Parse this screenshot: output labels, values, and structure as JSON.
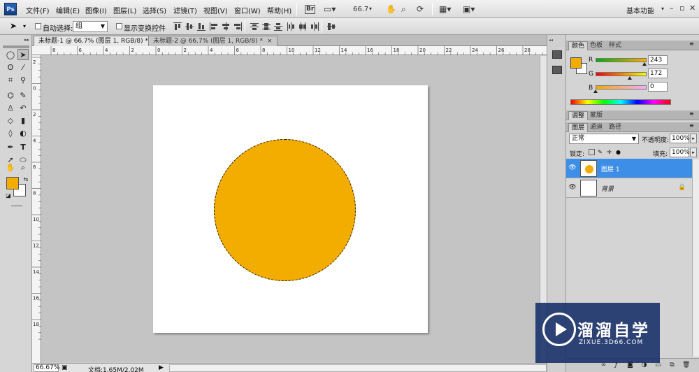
{
  "app": {
    "logo": "Ps",
    "workspace": "基本功能"
  },
  "menu": [
    "文件(F)",
    "编辑(E)",
    "图像(I)",
    "图层(L)",
    "选择(S)",
    "滤镜(T)",
    "视图(V)",
    "窗口(W)",
    "帮助(H)"
  ],
  "menubar": {
    "br_label": "Br",
    "zoom_value": "66.7"
  },
  "options": {
    "auto_select_label": "自动选择:",
    "auto_select_value": "组",
    "show_transform_label": "显示变换控件"
  },
  "tabs": [
    {
      "label": "未标题-1 @ 66.7% (图层 1, RGB/8) *",
      "close": "×"
    },
    {
      "label": "未标题-2 @ 66.7% (图层 1, RGB/8) *",
      "close": "×"
    }
  ],
  "ruler_top_marks": [
    "8",
    "6",
    "4",
    "2",
    "0",
    "2",
    "4",
    "6",
    "8",
    "10",
    "12",
    "14",
    "16",
    "18",
    "20",
    "22",
    "24",
    "26",
    "28"
  ],
  "ruler_left_marks": [
    "2",
    "0",
    "2",
    "4",
    "6",
    "8",
    "10",
    "12",
    "14",
    "16",
    "18"
  ],
  "status": {
    "zoom": "66.67%",
    "doc_info": "文档:1.65M/2.02M"
  },
  "colors": {
    "foreground": "#f3ac00",
    "background": "#ffffff"
  },
  "color_panel": {
    "tabs": [
      "颜色",
      "色板",
      "样式"
    ],
    "r_label": "R",
    "g_label": "G",
    "b_label": "B",
    "r": "243",
    "g": "172",
    "b": "0"
  },
  "adjust_panel": {
    "tabs": [
      "调整",
      "蒙版"
    ]
  },
  "layers_panel": {
    "tabs": [
      "图层",
      "通道",
      "路径"
    ],
    "blend_mode": "正常",
    "opacity_label": "不透明度:",
    "opacity": "100%",
    "lock_label": "锁定:",
    "fill_label": "填充:",
    "fill": "100%",
    "layers": [
      {
        "name": "图层 1",
        "selected": true
      },
      {
        "name": "背景",
        "selected": false
      }
    ]
  },
  "watermark": {
    "title": "溜溜自学",
    "url": "ZIXUE.3D66.COM"
  }
}
